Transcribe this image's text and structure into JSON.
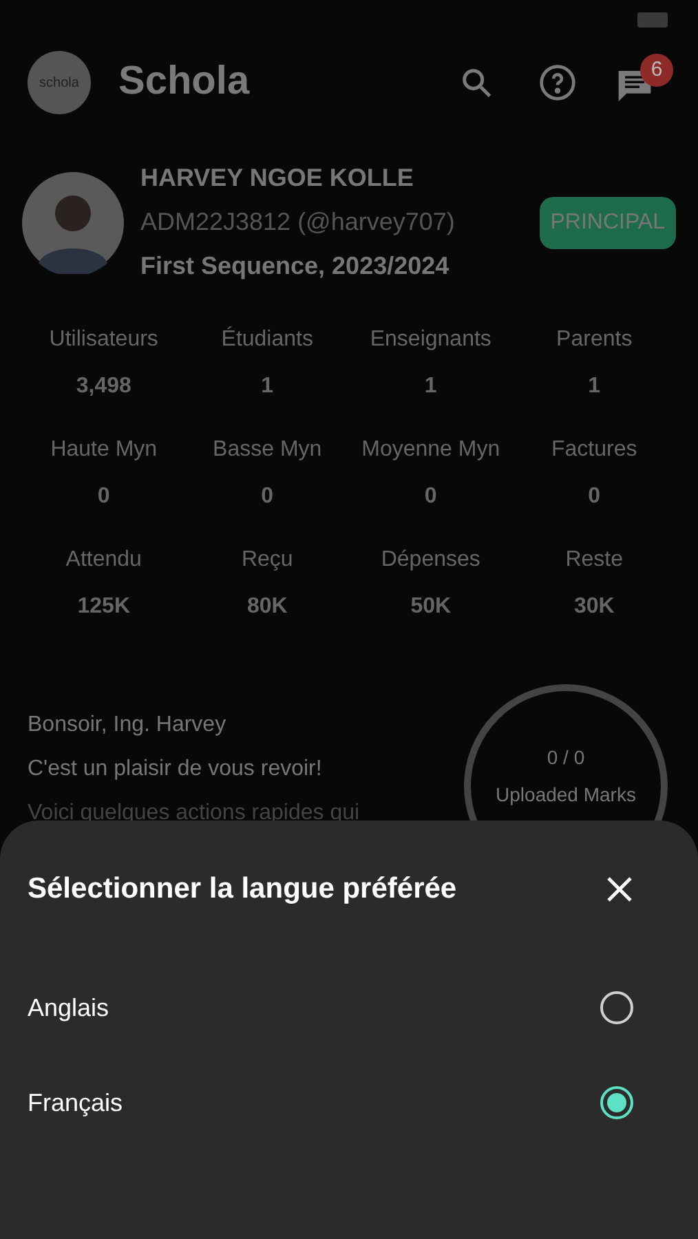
{
  "app_bar": {
    "logo_text": "schola",
    "title": "Schola",
    "notification_count": "6"
  },
  "profile": {
    "name": "HARVEY NGOE KOLLE",
    "id": "ADM22J3812 (@harvey707)",
    "term": "First Sequence, 2023/2024",
    "role": "PRINCIPAL"
  },
  "stats": [
    {
      "label": "Utilisateurs",
      "value": "3,498"
    },
    {
      "label": "Étudiants",
      "value": "1"
    },
    {
      "label": "Enseignants",
      "value": "1"
    },
    {
      "label": "Parents",
      "value": "1"
    },
    {
      "label": "Haute Myn",
      "value": "0"
    },
    {
      "label": "Basse Myn",
      "value": "0"
    },
    {
      "label": "Moyenne Myn",
      "value": "0"
    },
    {
      "label": "Factures",
      "value": "0"
    },
    {
      "label": "Attendu",
      "value": "125K"
    },
    {
      "label": "Reçu",
      "value": "80K"
    },
    {
      "label": "Dépenses",
      "value": "50K"
    },
    {
      "label": "Reste",
      "value": "30K"
    }
  ],
  "greeting": {
    "lines": [
      "Bonsoir, Ing. Harvey",
      "C'est un plaisir de vous revoir!",
      "Voici quelques actions rapides qui"
    ],
    "progress_value": "0 / 0",
    "progress_label": "Uploaded Marks"
  },
  "sheet": {
    "title": "Sélectionner la langue préférée",
    "options": [
      {
        "label": "Anglais",
        "selected": false
      },
      {
        "label": "Français",
        "selected": true
      }
    ]
  }
}
